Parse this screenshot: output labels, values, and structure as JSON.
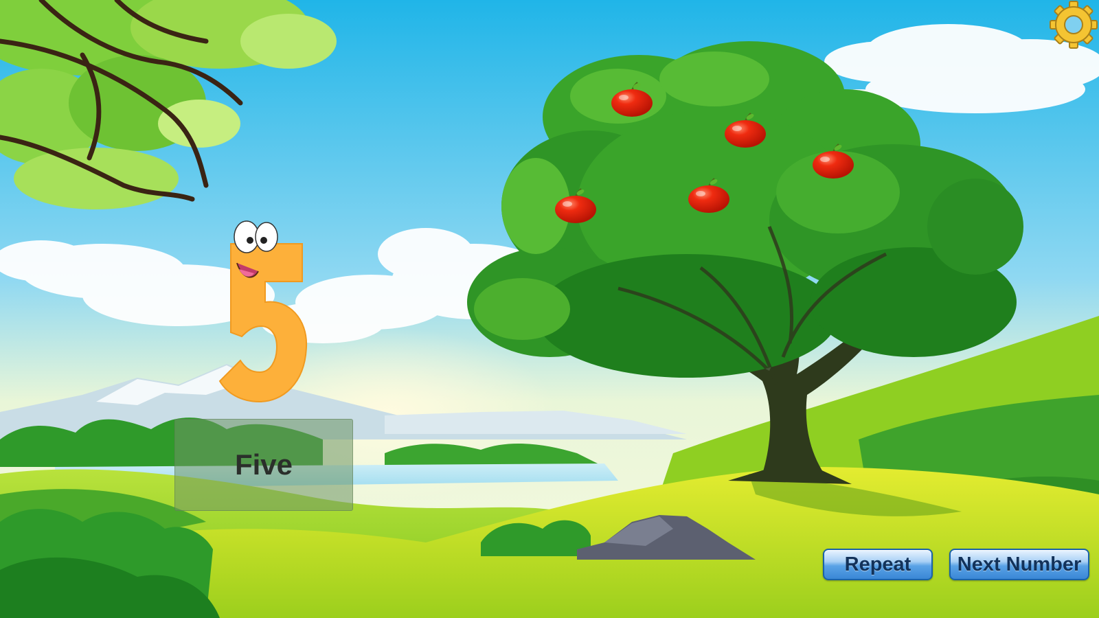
{
  "lesson": {
    "numeral": "5",
    "word": "Five",
    "apple_count": 5
  },
  "buttons": {
    "repeat_label": "Repeat",
    "next_label": "Next Number"
  },
  "icons": {
    "settings": "gear-icon",
    "apple": "apple-icon",
    "numeral_character": "numeral-five-character"
  },
  "colors": {
    "numeral": "#fdb03a",
    "apple": "#e8210c",
    "gear": "#f4c432",
    "sky": "#4fc3ec",
    "grass": "#9ad11f",
    "button_blue": "#3a87d6"
  }
}
